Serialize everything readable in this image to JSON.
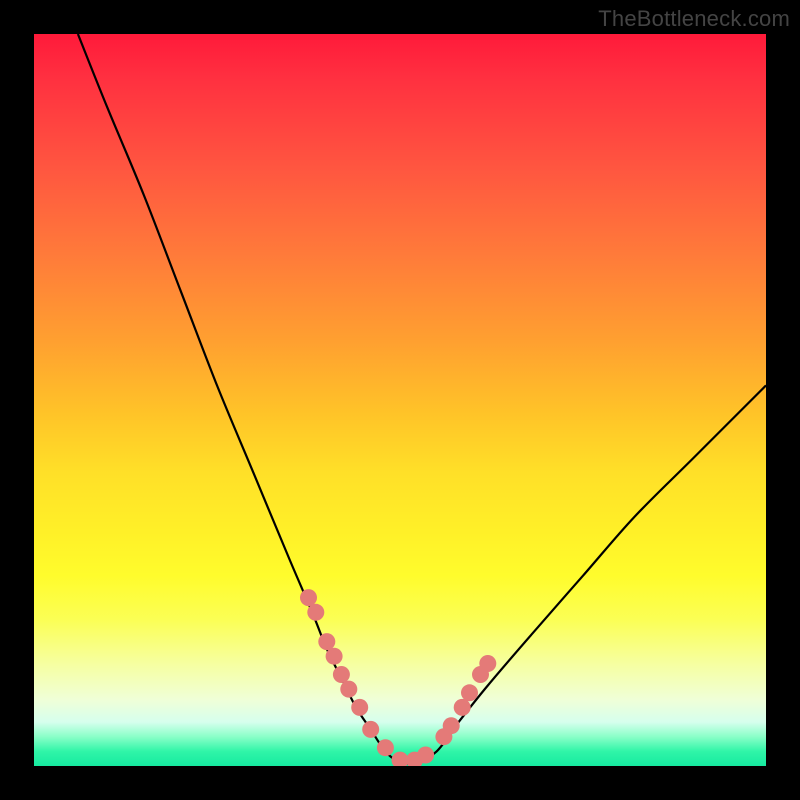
{
  "watermark": "TheBottleneck.com",
  "colors": {
    "frame": "#000000",
    "curve": "#000000",
    "marker_fill": "#e47a78",
    "marker_stroke": "#d96a68"
  },
  "chart_data": {
    "type": "line",
    "title": "",
    "xlabel": "",
    "ylabel": "",
    "xlim": [
      0,
      100
    ],
    "ylim": [
      0,
      100
    ],
    "grid": false,
    "legend": false,
    "curve_note": "V-shaped bottleneck curve; y ≈ 100 at x≈6 descending to y≈0 near x≈50, rising to y≈52 at x=100",
    "series": [
      {
        "name": "bottleneck-curve",
        "x": [
          6,
          10,
          15,
          20,
          25,
          30,
          35,
          38,
          40,
          42,
          44,
          46,
          48,
          50,
          52,
          55,
          58,
          62,
          68,
          75,
          82,
          90,
          100
        ],
        "y": [
          100,
          90,
          78,
          65,
          52,
          40,
          28,
          21,
          16,
          12,
          8,
          5,
          2,
          0.5,
          0.5,
          2,
          6,
          11,
          18,
          26,
          34,
          42,
          52
        ]
      }
    ],
    "markers_note": "Salmon-pink dot markers clustered on the lower walls and floor of the V",
    "markers": {
      "x": [
        37.5,
        38.5,
        40.0,
        41.0,
        42.0,
        43.0,
        44.5,
        46.0,
        48.0,
        50.0,
        52.0,
        53.5,
        56.0,
        57.0,
        58.5,
        59.5,
        61.0,
        62.0
      ],
      "y": [
        23.0,
        21.0,
        17.0,
        15.0,
        12.5,
        10.5,
        8.0,
        5.0,
        2.5,
        0.8,
        0.8,
        1.5,
        4.0,
        5.5,
        8.0,
        10.0,
        12.5,
        14.0
      ]
    }
  }
}
